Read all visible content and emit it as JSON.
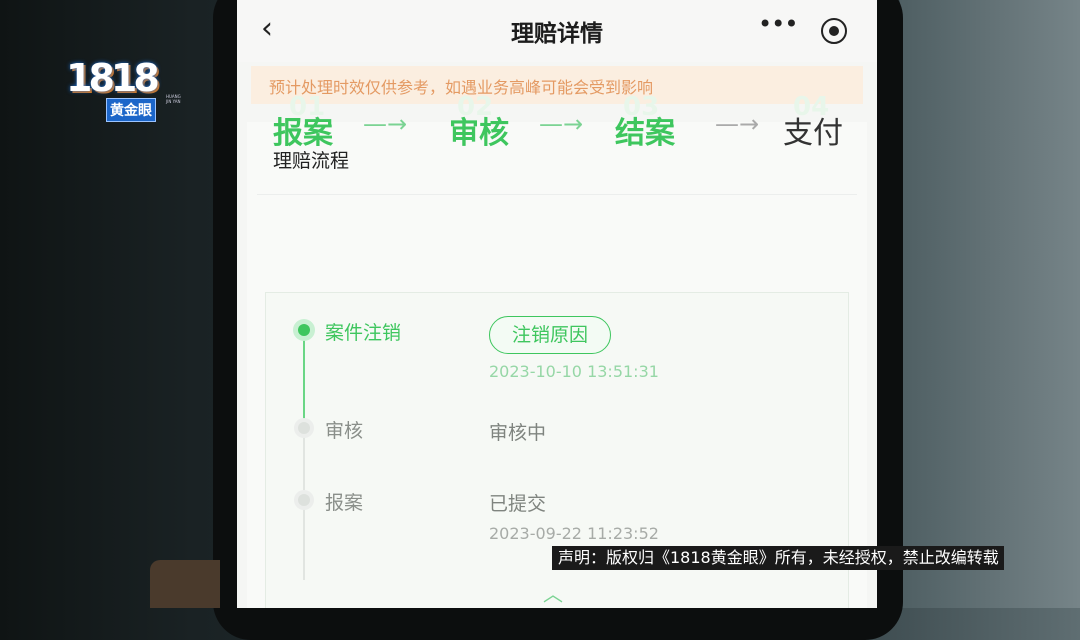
{
  "watermark": {
    "logo_number": "1818",
    "logo_text": "黄金眼",
    "logo_sub": "HUANG JIN YAN"
  },
  "navbar": {
    "back_icon": "chevron-left-icon",
    "title": "理赔详情",
    "more_icon": "more-dots-icon",
    "target_icon": "target-icon"
  },
  "notice": {
    "text": "预计处理时效仅供参考，如遇业务高峰可能会受到影响"
  },
  "process": {
    "title": "理赔流程",
    "steps": [
      {
        "label": "报案",
        "num": "01",
        "state": "done"
      },
      {
        "label": "审核",
        "num": "02",
        "state": "done"
      },
      {
        "label": "结案",
        "num": "03",
        "state": "done"
      },
      {
        "label": "支付",
        "num": "04",
        "state": "pending"
      }
    ],
    "arrow": "—→"
  },
  "timeline": [
    {
      "label": "案件注销",
      "status": "",
      "button": "注销原因",
      "time": "2023-10-10 13:51:31",
      "state": "active"
    },
    {
      "label": "审核",
      "status": "审核中",
      "time": "",
      "state": "idle"
    },
    {
      "label": "报案",
      "status": "已提交",
      "time": "2023-09-22 11:23:52",
      "state": "idle"
    }
  ],
  "disclaimer": "声明：版权归《1818黄金眼》所有，未经授权，禁止改编转载",
  "colors": {
    "accent": "#3ec65e",
    "notice_text": "#e49a63",
    "notice_bg": "#fbeee0"
  }
}
